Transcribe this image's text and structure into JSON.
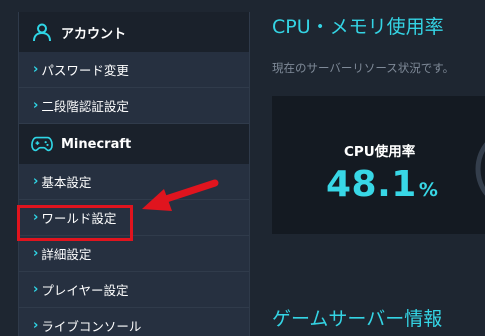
{
  "sidebar": {
    "account_section": {
      "title": "アカウント",
      "icon": "user-icon"
    },
    "account_items": [
      {
        "label": "パスワード変更"
      },
      {
        "label": "二段階認証設定"
      }
    ],
    "minecraft_section": {
      "title": "Minecraft",
      "icon": "gamepad-icon"
    },
    "minecraft_items": [
      {
        "label": "基本設定"
      },
      {
        "label": "ワールド設定"
      },
      {
        "label": "詳細設定"
      },
      {
        "label": "プレイヤー設定"
      },
      {
        "label": "ライブコンソール"
      }
    ],
    "chevron": "›",
    "highlighted_item": "ワールド設定"
  },
  "main": {
    "title": "CPU・メモリ使用率",
    "subtitle": "現在のサーバーリソース状況です。",
    "cpu_card": {
      "label": "CPU使用率",
      "value": "48.1",
      "unit": "%"
    },
    "game_server_title": "ゲームサーバー情報"
  },
  "colors": {
    "accent": "#34d4e4",
    "background": "#1e2631",
    "sidebar": "#263040",
    "card": "#141a22",
    "highlight": "#e0141e"
  }
}
